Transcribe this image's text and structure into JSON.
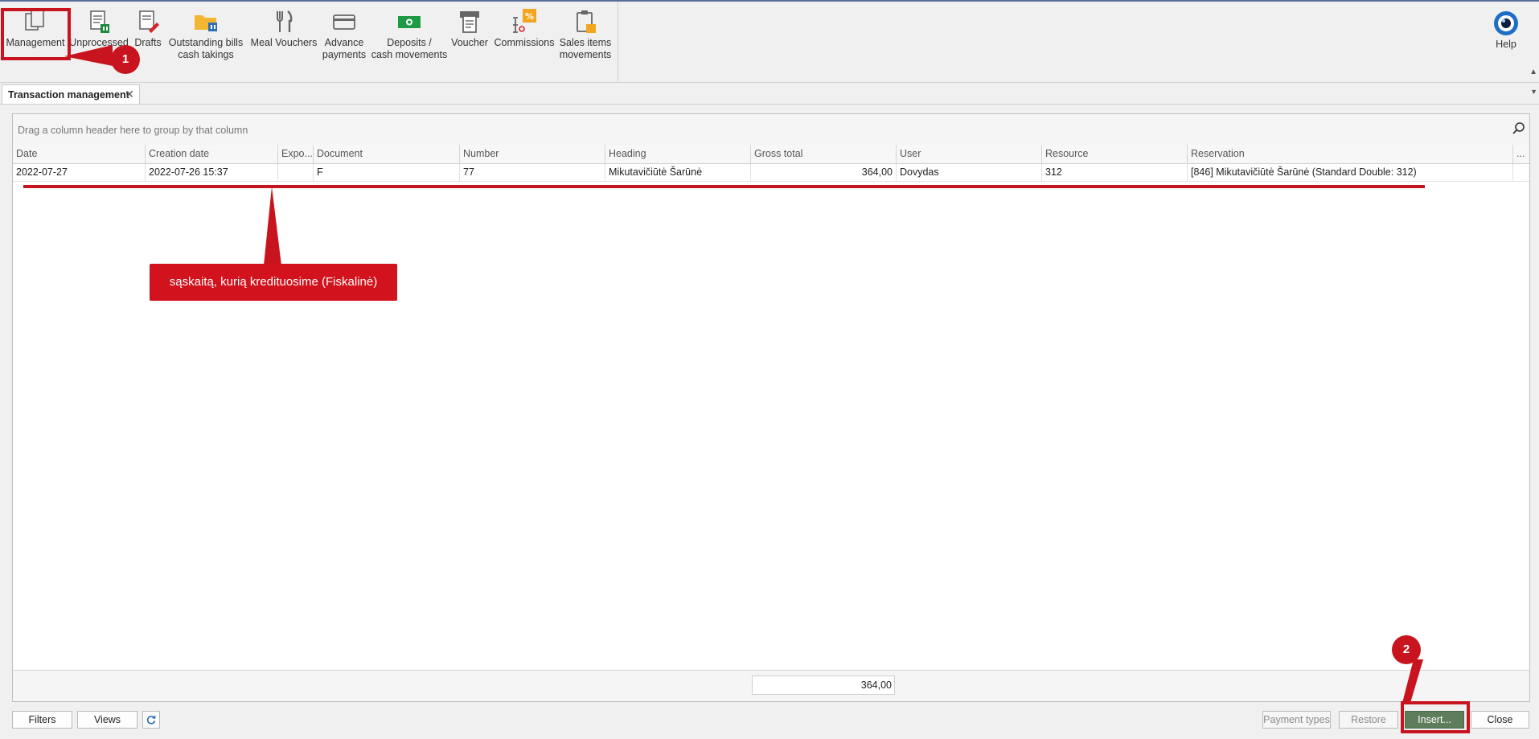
{
  "ribbon": {
    "buttons": [
      {
        "label": "Management",
        "icon": "management-icon"
      },
      {
        "label": "Unprocessed\nbills",
        "icon": "unprocessed-bills-icon"
      },
      {
        "label": "Drafts",
        "icon": "drafts-icon"
      },
      {
        "label": "Outstanding bills\ncash takings",
        "icon": "outstanding-bills-icon"
      },
      {
        "label": "Meal Vouchers",
        "icon": "meal-vouchers-icon"
      },
      {
        "label": "Advance\npayments",
        "icon": "advance-payments-icon"
      },
      {
        "label": "Deposits /\ncash movements",
        "icon": "deposits-icon"
      },
      {
        "label": "Voucher",
        "icon": "voucher-icon"
      },
      {
        "label": "Commissions",
        "icon": "commissions-icon"
      },
      {
        "label": "Sales items\nmovements",
        "icon": "sales-items-icon"
      }
    ],
    "help_label": "Help"
  },
  "tab": {
    "title": "Transaction management"
  },
  "grid": {
    "group_hint": "Drag a column header here to group by that column",
    "columns": [
      "Date",
      "Creation date",
      "Expo...",
      "Document",
      "Number",
      "Heading",
      "Gross total",
      "User",
      "Resource",
      "Reservation",
      "..."
    ],
    "row": {
      "date": "2022-07-27",
      "creation_date": "2022-07-26 15:37",
      "export": "",
      "document": "F",
      "number": "77",
      "heading": "Mikutavičiūtė Šarūnė",
      "gross_total": "364,00",
      "user": "Dovydas",
      "resource": "312",
      "reservation": "[846] Mikutavičiūtė Šarūnė (Standard Double: 312)"
    },
    "footer_sum": "364,00"
  },
  "buttons": {
    "filters": "Filters",
    "views": "Views",
    "payment_types": "Payment types",
    "restore": "Restore",
    "insert": "Insert...",
    "close": "Close"
  },
  "annotations": {
    "badge1": "1",
    "badge2": "2",
    "callout": "sąskaitą, kurią kredituosime (Fiskalinė)"
  },
  "colors": {
    "annotation_red": "#c8141e",
    "insert_button": "#5e7d5b"
  }
}
